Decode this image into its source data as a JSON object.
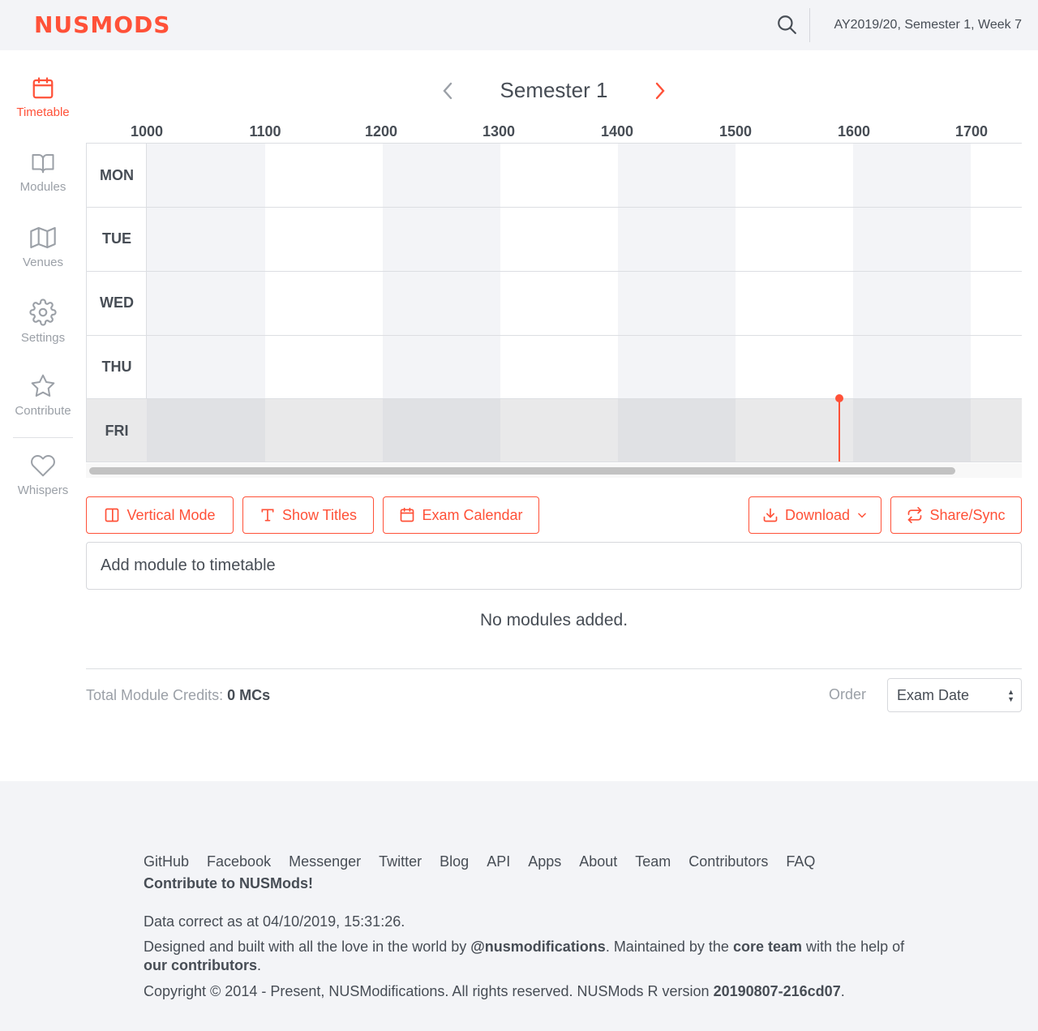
{
  "header": {
    "brand": "NUSMODS",
    "week_info": "AY2019/20, Semester 1, Week 7"
  },
  "sidebar": {
    "items": [
      {
        "label": "Timetable",
        "icon": "calendar-icon",
        "active": true
      },
      {
        "label": "Modules",
        "icon": "book-icon",
        "active": false
      },
      {
        "label": "Venues",
        "icon": "map-icon",
        "active": false
      },
      {
        "label": "Settings",
        "icon": "gear-icon",
        "active": false
      },
      {
        "label": "Contribute",
        "icon": "star-icon",
        "active": false
      },
      {
        "label": "Whispers",
        "icon": "heart-icon",
        "active": false
      }
    ]
  },
  "timetable": {
    "semester_title": "Semester 1",
    "hours": [
      "1000",
      "1100",
      "1200",
      "1300",
      "1400",
      "1500",
      "1600",
      "1700"
    ],
    "days": [
      "MON",
      "TUE",
      "WED",
      "THU",
      "FRI"
    ],
    "current_day": "FRI"
  },
  "actions": {
    "vertical_mode": "Vertical Mode",
    "show_titles": "Show Titles",
    "exam_calendar": "Exam Calendar",
    "download": "Download",
    "share_sync": "Share/Sync"
  },
  "modules": {
    "add_placeholder": "Add module to timetable",
    "empty_message": "No modules added.",
    "total_label": "Total Module Credits:",
    "total_value": "0 MCs",
    "order_label": "Order",
    "order_selected": "Exam Date"
  },
  "footer": {
    "links": [
      "GitHub",
      "Facebook",
      "Messenger",
      "Twitter",
      "Blog",
      "API",
      "Apps",
      "About",
      "Team",
      "Contributors",
      "FAQ"
    ],
    "contribute": "Contribute to NUSMods!",
    "data_correct": "Data correct as at 04/10/2019, 15:31:26.",
    "credits_pre": "Designed and built with all the love in the world by",
    "credits_handle": "@nusmodifications",
    "credits_mid": ". Maintained by the",
    "credits_team": "core team",
    "credits_with": "with the",
    "credits_help": "help of",
    "credits_contributors": "our contributors",
    "copyright_pre": "Copyright © 2014 - Present, NUSModifications. All rights reserved. NUSMods R version",
    "version": "20190807-216cd07"
  },
  "colors": {
    "accent": "#ff5138",
    "text": "#474d55",
    "muted": "#9ba0a7",
    "background_alt": "#f3f4f7"
  }
}
